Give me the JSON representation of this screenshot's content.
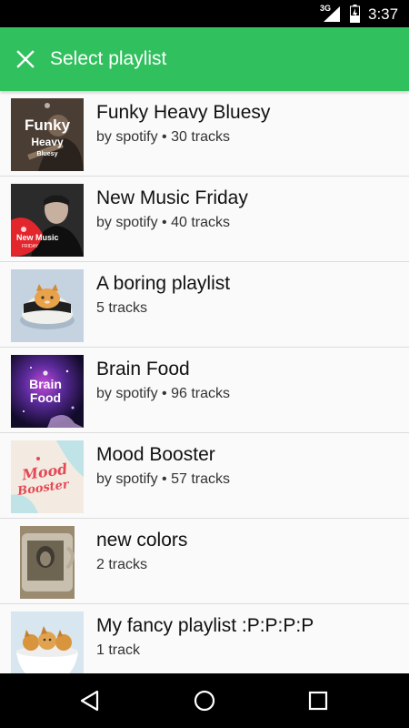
{
  "status_bar": {
    "network": "3G",
    "time": "3:37"
  },
  "app_bar": {
    "title": "Select playlist",
    "close_icon": "close-icon"
  },
  "playlists": [
    {
      "name": "Funky Heavy Bluesy",
      "subtitle": "by spotify • 30 tracks",
      "cover_words": [
        "Funky",
        "Heavy",
        "Bluesy"
      ]
    },
    {
      "name": "New Music Friday",
      "subtitle": "by spotify • 40 tracks",
      "cover_words": [
        "New Music",
        "FRIDAY"
      ]
    },
    {
      "name": "A boring playlist",
      "subtitle": "5 tracks"
    },
    {
      "name": "Brain Food",
      "subtitle": "by spotify • 96 tracks",
      "cover_words": [
        "Brain",
        "Food"
      ]
    },
    {
      "name": "Mood Booster",
      "subtitle": "by spotify • 57 tracks",
      "cover_words": [
        "Mood",
        "Booster"
      ]
    },
    {
      "name": "new colors",
      "subtitle": "2 tracks"
    },
    {
      "name": "My fancy playlist :P:P:P:P",
      "subtitle": "1 track"
    }
  ],
  "nav_bar": {
    "buttons": [
      "back-icon",
      "home-icon",
      "recents-icon"
    ]
  },
  "colors": {
    "accent": "#31c05e",
    "status_bar": "#000000",
    "list_background": "#fafafa",
    "divider": "#dcdcdc"
  }
}
